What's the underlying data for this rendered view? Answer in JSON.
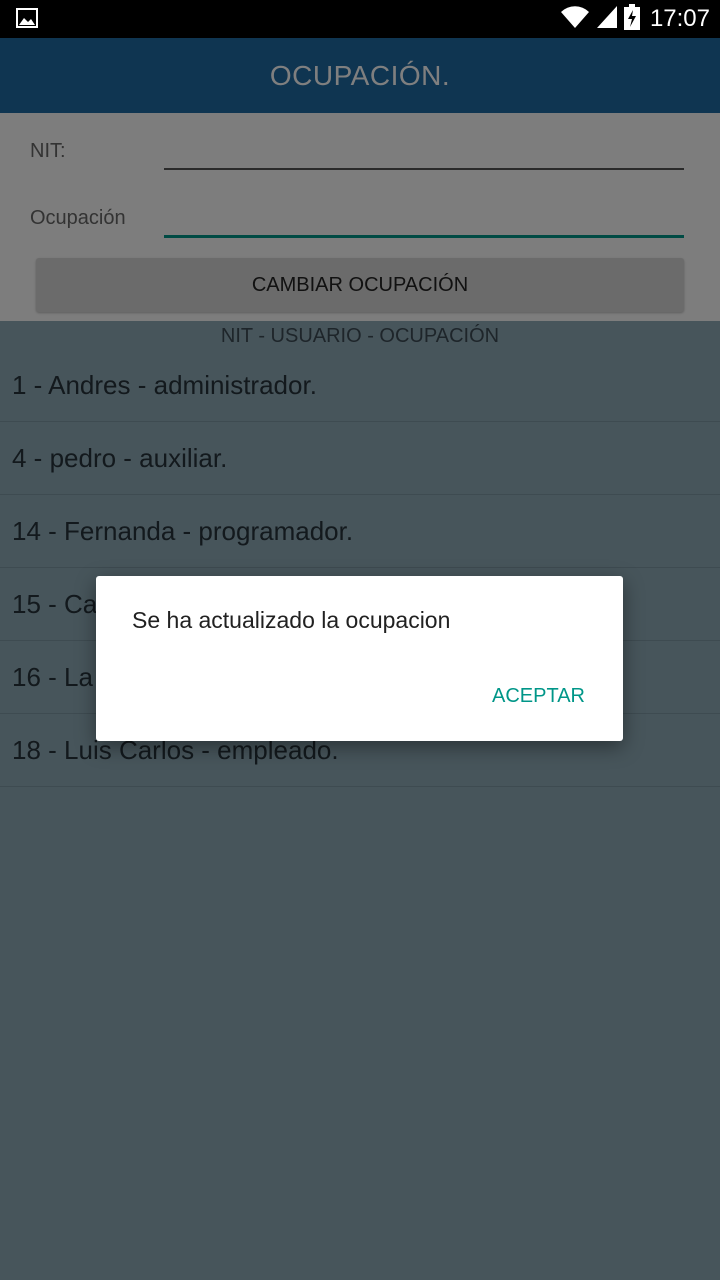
{
  "status_bar": {
    "time": "17:07",
    "icons": [
      "gallery-icon",
      "wifi-icon",
      "signal-icon",
      "battery-charging-icon"
    ]
  },
  "app_bar": {
    "title": "OCUPACIÓN."
  },
  "form": {
    "nit_label": "NIT:",
    "nit_value": "",
    "occupation_label": "Ocupación",
    "occupation_value": "",
    "submit_label": "CAMBIAR OCUPACIÓN"
  },
  "list": {
    "header": "NIT - USUARIO - OCUPACIÓN",
    "items": [
      "1 - Andres - administrador.",
      "4 - pedro - auxiliar.",
      "14 - Fernanda - programador.",
      "15 - Ca",
      "16 - La",
      "18 - Luis Carlos - empleado."
    ]
  },
  "dialog": {
    "message": "Se ha actualizado la ocupacion",
    "ok_label": "ACEPTAR"
  },
  "colors": {
    "app_bar": "#1e6aa3",
    "list_background": "#8eaab6",
    "accent": "#009688"
  }
}
